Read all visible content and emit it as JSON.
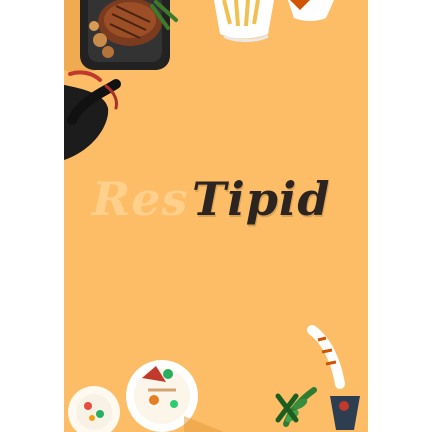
{
  "logo": {
    "part1": "Res",
    "part2": "Tipid"
  },
  "colors": {
    "background": "#fdbd66",
    "logo_light": "#ffcf8c",
    "logo_dark": "#2b2420"
  },
  "illustrations": {
    "top_left": "grilled-steak-on-skillet-icon",
    "top_right": "french-fries-icon",
    "bottom_left": "salad-bowl-icon",
    "bottom_right": "herb-garnish-icon"
  }
}
